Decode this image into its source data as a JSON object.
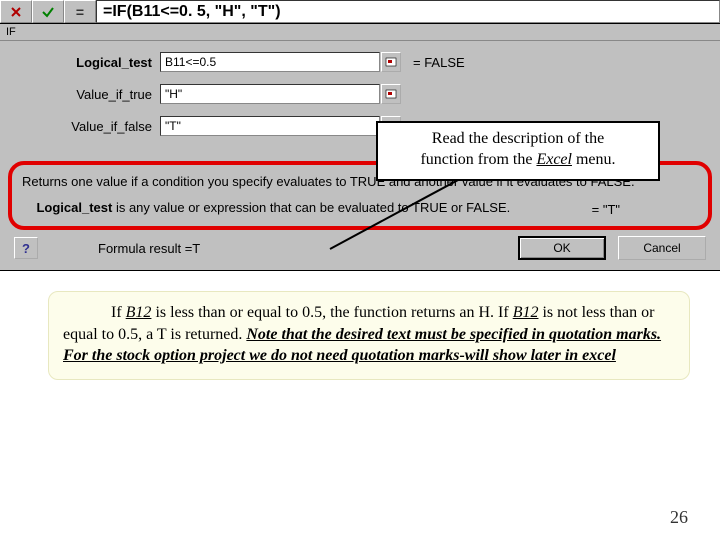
{
  "formula_bar": {
    "formula": "=IF(B11<=0. 5, \"H\", \"T\")"
  },
  "dialog": {
    "fn_name": "IF",
    "args": {
      "logical_test": {
        "label": "Logical_test",
        "value": "B11<=0.5",
        "result": "= FALSE"
      },
      "value_if_true": {
        "label": "Value_if_true",
        "value": "\"H\"",
        "result": ""
      },
      "value_if_false": {
        "label": "Value_if_false",
        "value": "\"T\"",
        "result": ""
      }
    },
    "under_result": "= \"T\"",
    "description": "Returns one value if a condition you specify evaluates to TRUE and another value if it evaluates to FALSE.",
    "logical_desc_label": "Logical_test",
    "logical_desc": "is any value or expression that can be evaluated to TRUE or FALSE.",
    "formula_result_label": "Formula result =",
    "formula_result_value": "T",
    "ok": "OK",
    "cancel": "Cancel"
  },
  "callout": {
    "line1": "Read the description of the",
    "line2_a": "function from the ",
    "line2_excel": "Excel",
    "line2_b": " menu."
  },
  "note": {
    "text_a": "If ",
    "b12": "B12",
    "text_b": " is less than or equal to 0.5, the function returns an H.  If ",
    "text_c": " is not less than or equal to 0.5, a T is returned. ",
    "note_text": "Note that the desired text must be specified in quotation marks. For the stock option project we do not need quotation marks-will show later in excel"
  },
  "page_number": "26"
}
